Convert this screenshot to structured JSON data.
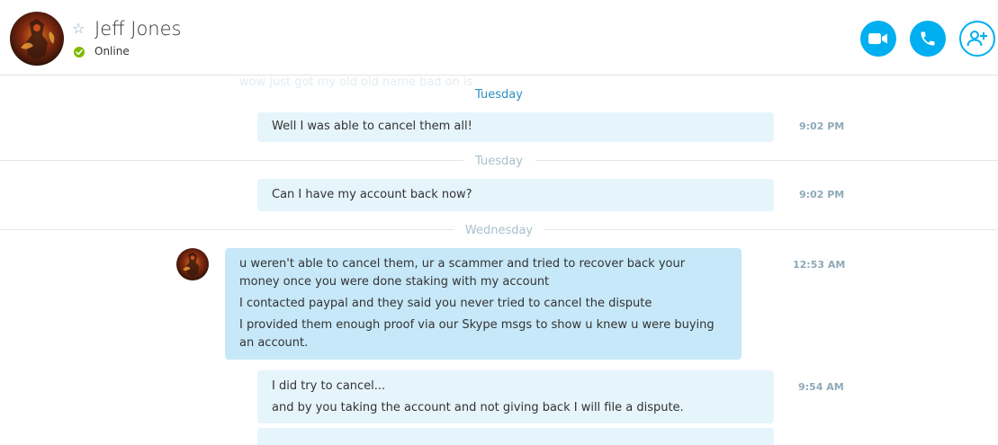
{
  "header": {
    "contact_name": "Jeff Jones",
    "presence": "Online",
    "buttons": {
      "video_call": "video-camera-icon",
      "voice_call": "phone-icon",
      "add_people": "add-contact-icon"
    }
  },
  "colors": {
    "accent": "#00aff0",
    "online": "#7fba00",
    "bubble_outgoing": "#e6f4fb",
    "bubble_incoming": "#c7e8f8",
    "day_active": "#2e8fc2"
  },
  "chat": {
    "ghost_message": "wow just got my old old name bad on is",
    "day_labels": [
      "Tuesday",
      "Tuesday",
      "Wednesday"
    ],
    "messages": [
      {
        "direction": "outgoing",
        "lines": [
          "Well I was able to cancel them all!"
        ],
        "time": "9:02 PM"
      },
      {
        "direction": "outgoing",
        "lines": [
          "Can I have my account back now?"
        ],
        "time": "9:02 PM"
      },
      {
        "direction": "incoming",
        "lines": [
          "u weren't able to cancel them, ur a scammer and tried to recover back your money once you were done staking with my account",
          "I contacted paypal and they said you never tried to cancel the dispute",
          "I provided them enough proof via our Skype msgs to show u knew u were buying an account."
        ],
        "time": "12:53 AM"
      },
      {
        "direction": "outgoing",
        "lines": [
          "I did try to cancel...",
          "and by you taking the account and not giving back I will file a dispute."
        ],
        "time": "9:54 AM"
      }
    ]
  }
}
